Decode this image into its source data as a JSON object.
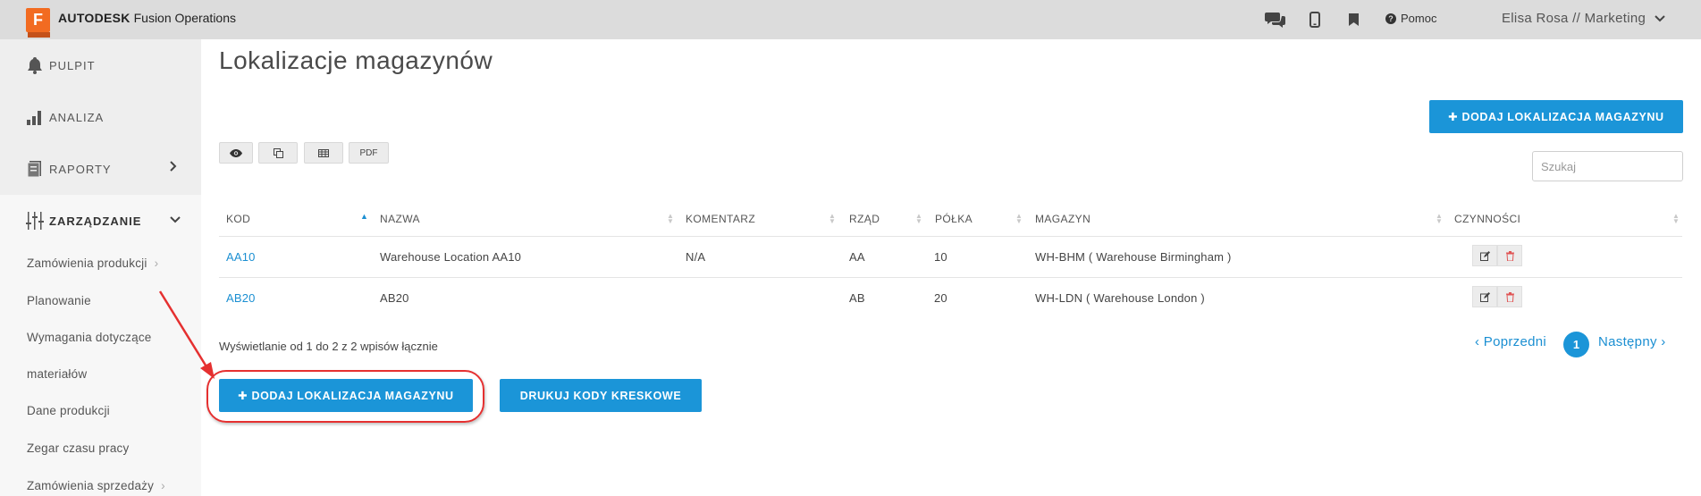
{
  "app": {
    "logo_letter": "F",
    "brand_bold": "AUTODESK",
    "brand_rest": "Fusion Operations",
    "brand_color": "#f26b21"
  },
  "topbar": {
    "icons": [
      "chat-icon",
      "mobile-icon",
      "bookmark-icon"
    ],
    "help_label": "Pomoc",
    "user_label": "Elisa Rosa // Marketing"
  },
  "sidebar": {
    "main": [
      {
        "label": "PULPIT",
        "icon": "bell-icon"
      },
      {
        "label": "ANALIZA",
        "icon": "bar-chart-icon"
      },
      {
        "label": "RAPORTY",
        "icon": "report-icon"
      },
      {
        "label": "ZARZĄDZANIE",
        "icon": "sliders-icon"
      }
    ],
    "sub": [
      {
        "label": "Zamówienia produkcji",
        "chevron": "›"
      },
      {
        "label": "Planowanie"
      },
      {
        "label": "Wymagania dotyczące"
      },
      {
        "label": "materiałów"
      },
      {
        "label": "Dane produkcji"
      },
      {
        "label": "Zegar czasu pracy"
      },
      {
        "label": "Zamówienia sprzedaży",
        "chevron": "›"
      }
    ]
  },
  "main": {
    "title": "Lokalizacje magazynów",
    "add_button_top": "✚ DODAJ LOKALIZACJA MAGAZYNU",
    "toolbar": {
      "pdf_label": "PDF"
    },
    "search_placeholder": "Szukaj",
    "table": {
      "headers": [
        "KOD",
        "NAZWA",
        "KOMENTARZ",
        "RZĄD",
        "PÓŁKA",
        "MAGAZYN",
        "CZYNNOŚCI"
      ],
      "rows": [
        {
          "kod": "AA10",
          "nazwa": "Warehouse Location AA10",
          "komentarz": "N/A",
          "rzad": "AA",
          "polka": "10",
          "magazyn": "WH-BHM ( Warehouse Birmingham )"
        },
        {
          "kod": "AB20",
          "nazwa": "AB20",
          "komentarz": "",
          "rzad": "AB",
          "polka": "20",
          "magazyn": "WH-LDN ( Warehouse London )"
        }
      ]
    },
    "info": "Wyświetlanie od 1 do 2 z 2 wpisów łącznie",
    "pagination": {
      "prev": "‹ Poprzedni",
      "current": "1",
      "next": "Następny ›"
    },
    "add_button_bottom": "✚ DODAJ LOKALIZACJA MAGAZYNU",
    "print_button": "DRUKUJ KODY KRESKOWE",
    "accent_color": "#1b95d8",
    "highlight_color": "#e53030"
  }
}
